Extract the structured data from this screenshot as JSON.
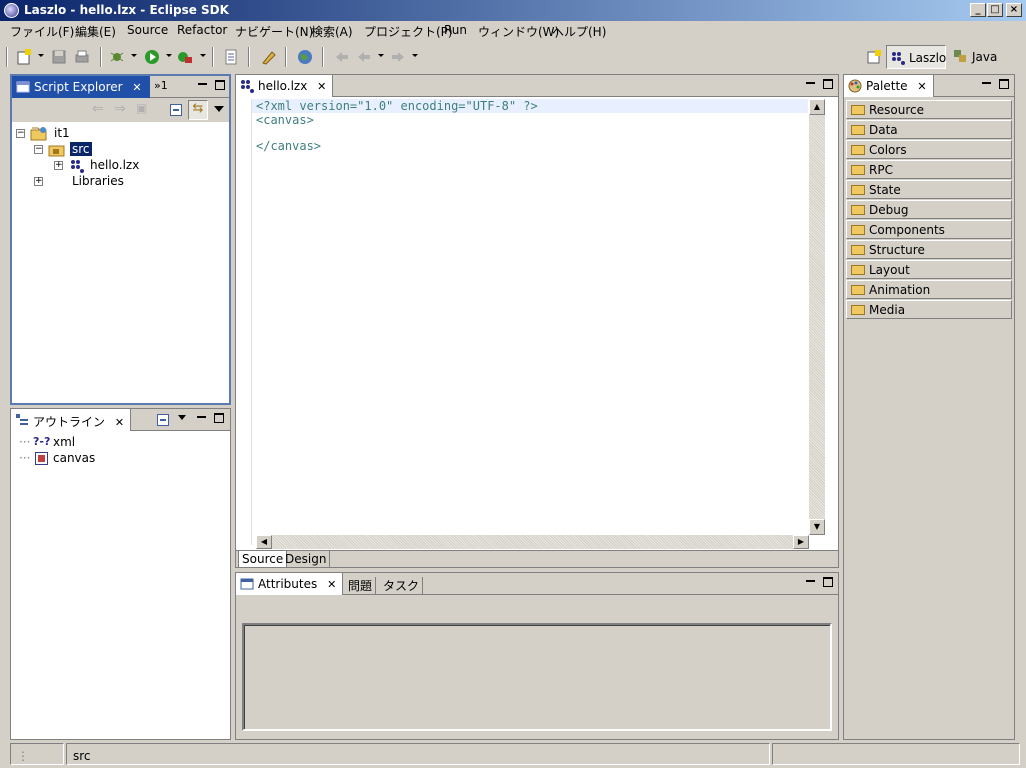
{
  "window": {
    "title": "Laszlo - hello.lzx - Eclipse SDK"
  },
  "menu": [
    "ファイル(F)",
    "編集(E)",
    "Source",
    "Refactor",
    "ナビゲート(N)",
    "検索(A)",
    "プロジェクト(P)",
    "Run",
    "ウィンドウ(W)",
    "ヘルプ(H)"
  ],
  "perspectives": {
    "laszlo": "Laszlo",
    "java": "Java"
  },
  "script_explorer": {
    "tab_label": "Script Explorer",
    "overflow_label": "»1",
    "tree": {
      "project": "it1",
      "src": "src",
      "file": "hello.lzx",
      "libraries": "Libraries"
    }
  },
  "outline": {
    "tab_label": "アウトライン",
    "items": [
      {
        "icon": "?-?",
        "label": "xml"
      },
      {
        "icon": "",
        "label": "canvas"
      }
    ]
  },
  "editor": {
    "tab_label": "hello.lzx",
    "lines": [
      "<?xml version=\"1.0\" encoding=\"UTF-8\" ?>",
      "<canvas>",
      "",
      "</canvas>"
    ],
    "bottom_tabs": [
      "Source",
      "Design"
    ]
  },
  "attributes": {
    "tabs": [
      "Attributes",
      "問題",
      "タスク"
    ]
  },
  "palette": {
    "tab_label": "Palette",
    "items": [
      "Resource",
      "Data",
      "Colors",
      "RPC",
      "State",
      "Debug",
      "Components",
      "Structure",
      "Layout",
      "Animation",
      "Media"
    ]
  },
  "status": {
    "text": "src"
  },
  "colors": {
    "selection": "#0a246a",
    "xml_tag": "#3f7f7f",
    "xml_string": "#2a00ff",
    "folder": "#f0c860"
  }
}
